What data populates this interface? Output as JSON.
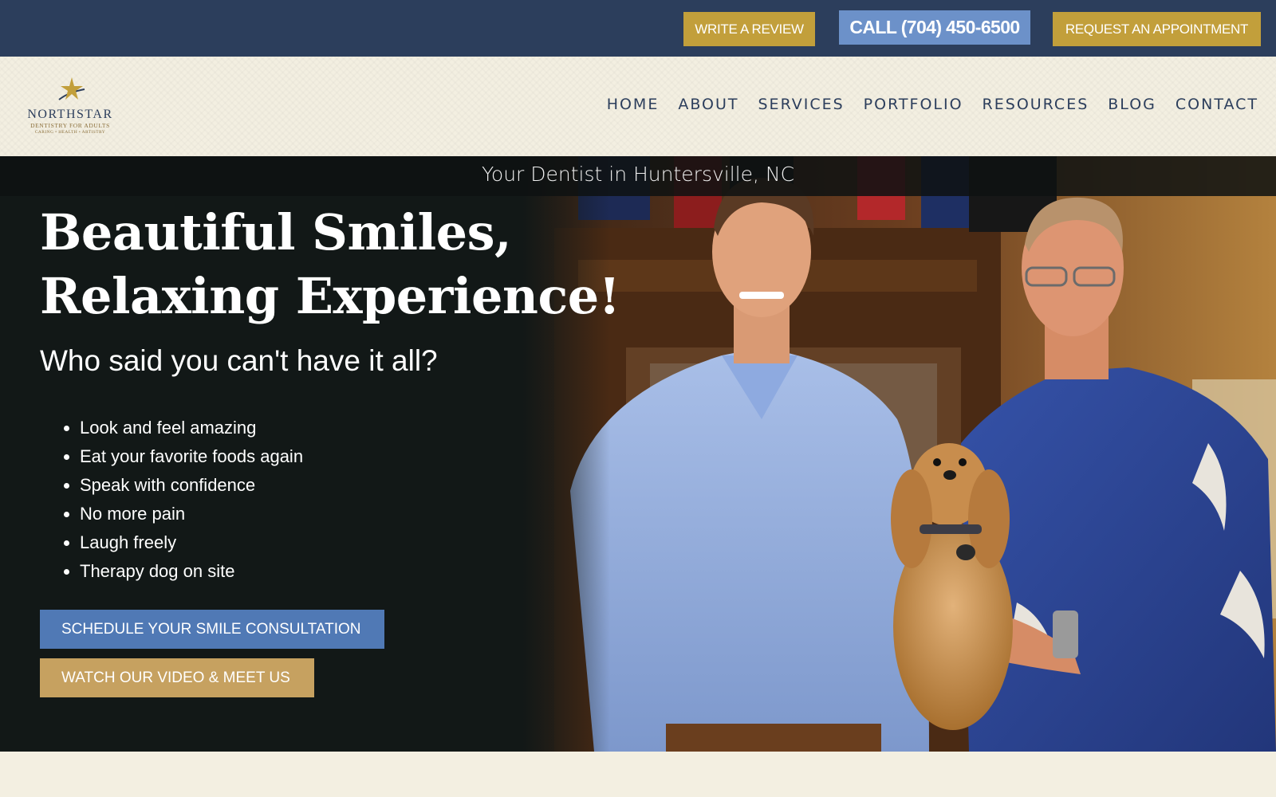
{
  "topbar": {
    "review_label": "WRITE A REVIEW",
    "call_label": "CALL (704) 450-6500",
    "appointment_label": "REQUEST AN APPOINTMENT"
  },
  "logo": {
    "brand": "NORTHSTAR",
    "tagline": "DENTISTRY FOR ADULTS",
    "subtagline": "CARING • HEALTH • ARTISTRY"
  },
  "nav": {
    "items": [
      {
        "label": "HOME"
      },
      {
        "label": "ABOUT"
      },
      {
        "label": "SERVICES"
      },
      {
        "label": "PORTFOLIO"
      },
      {
        "label": "RESOURCES"
      },
      {
        "label": "BLOG"
      },
      {
        "label": "CONTACT"
      }
    ]
  },
  "hero": {
    "subtitle": "Your Dentist in Huntersville, NC",
    "headline_line1": "Beautiful Smiles,",
    "headline_line2": "Relaxing Experience!",
    "tagline": "Who said you can't have it all?",
    "bullets": [
      "Look and feel amazing",
      "Eat your favorite foods again",
      "Speak with confidence",
      "No more pain",
      "Laugh freely",
      "Therapy dog on site"
    ],
    "cta_schedule": "SCHEDULE YOUR SMILE CONSULTATION",
    "cta_video": "WATCH OUR VIDEO & MEET US"
  },
  "colors": {
    "navy": "#2c3e5c",
    "gold": "#c29f3b",
    "blue": "#6c91c9",
    "cta_blue": "#5079b5",
    "cta_gold": "#c6a160",
    "cream": "#f3efe1"
  },
  "icons": [
    "north-star-logo-icon"
  ]
}
